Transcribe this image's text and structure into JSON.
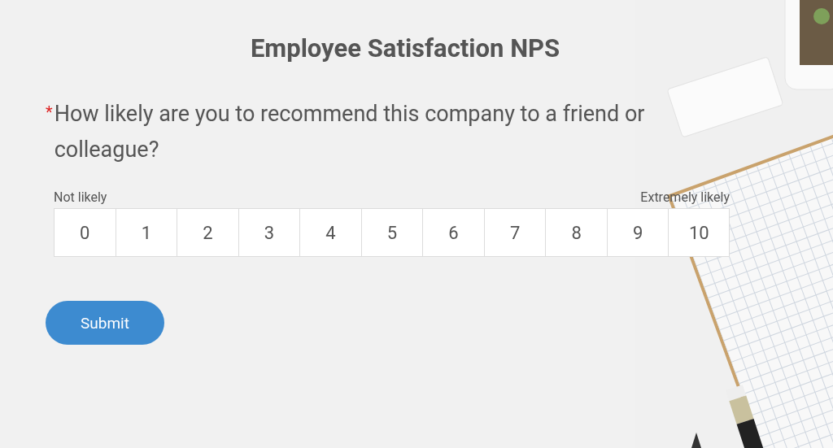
{
  "form": {
    "title": "Employee Satisfaction NPS",
    "question": {
      "required_mark": "*",
      "text": "How likely are you to recommend this company to a friend or colleague?"
    },
    "scale": {
      "low_label": "Not likely",
      "high_label": "Extremely likely",
      "options": [
        {
          "label": "0",
          "selected": false
        },
        {
          "label": "1",
          "selected": false
        },
        {
          "label": "2",
          "selected": false
        },
        {
          "label": "3",
          "selected": false
        },
        {
          "label": "4",
          "selected": false
        },
        {
          "label": "5",
          "selected": false
        },
        {
          "label": "6",
          "selected": false
        },
        {
          "label": "7",
          "selected": false
        },
        {
          "label": "8",
          "selected": false
        },
        {
          "label": "9",
          "selected": false
        },
        {
          "label": "10",
          "selected": false
        }
      ]
    },
    "submit_button": "Submit"
  }
}
